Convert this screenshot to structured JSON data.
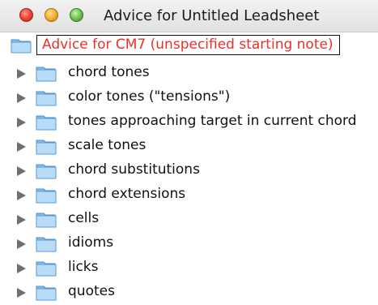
{
  "window": {
    "title": "Advice for Untitled Leadsheet"
  },
  "tree": {
    "root_label": "Advice for CM7 (unspecified starting note)",
    "items": [
      {
        "label": "chord tones"
      },
      {
        "label": "color tones (\"tensions\")"
      },
      {
        "label": "tones approaching target in current chord"
      },
      {
        "label": "scale tones"
      },
      {
        "label": "chord substitutions"
      },
      {
        "label": "chord extensions"
      },
      {
        "label": "cells"
      },
      {
        "label": "idioms"
      },
      {
        "label": "licks"
      },
      {
        "label": "quotes"
      }
    ]
  },
  "colors": {
    "root_label_text": "#e5332a",
    "folder_blue": "#8ec5ec"
  },
  "icons": {
    "folder": "folder-icon",
    "disclosure": "disclosure-triangle-icon"
  }
}
